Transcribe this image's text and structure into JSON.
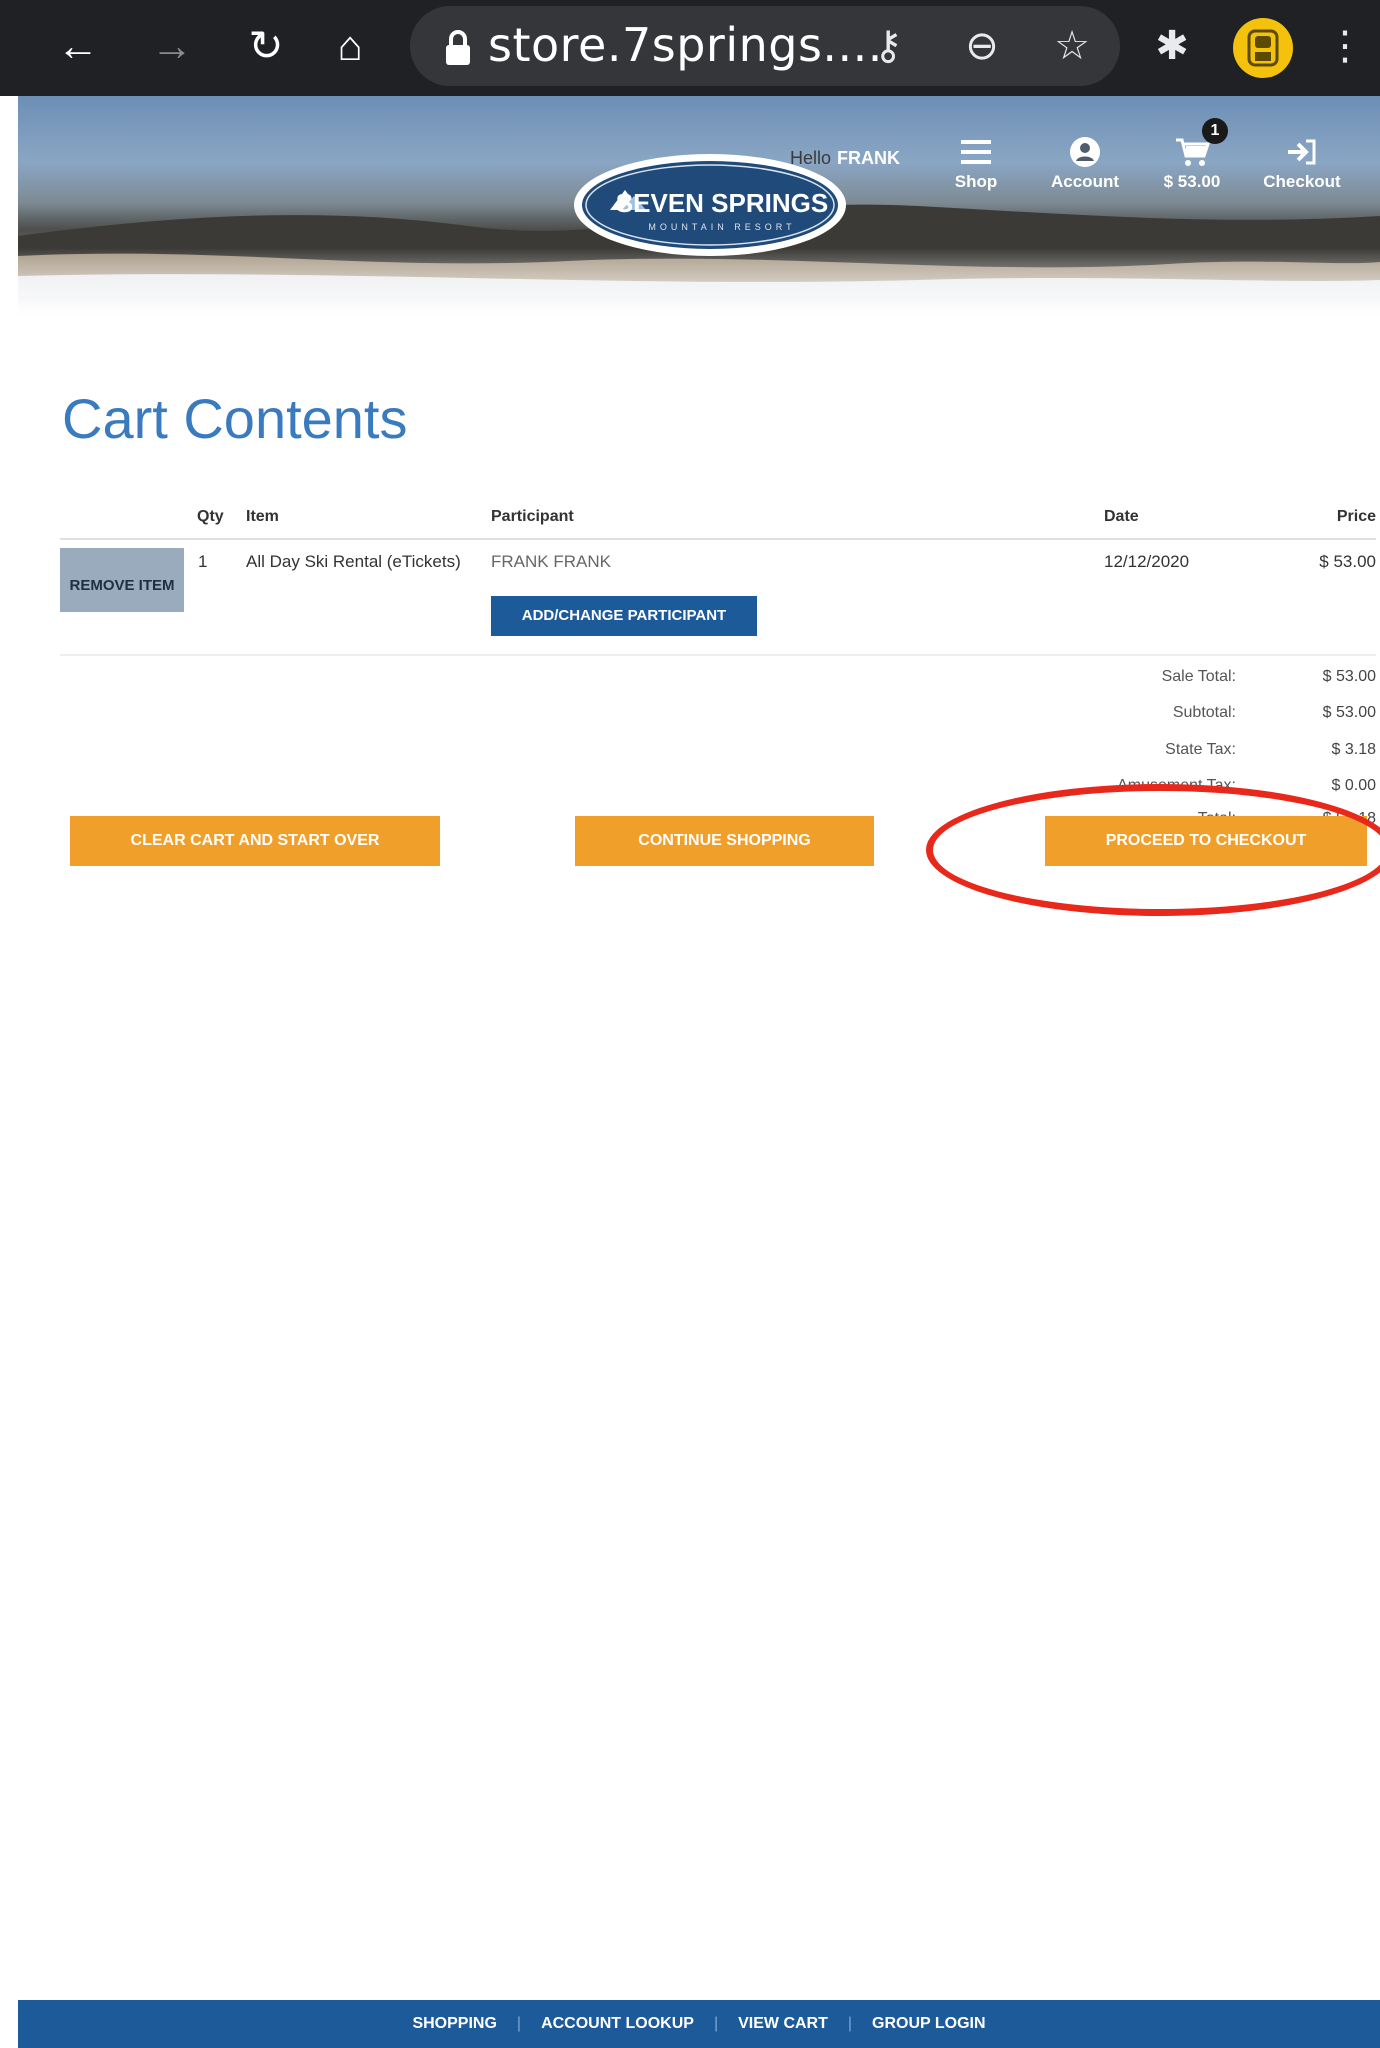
{
  "browser": {
    "url": "store.7springs....",
    "back_icon": "←",
    "forward_icon": "→",
    "reload_icon": "↻",
    "home_icon": "⌂",
    "key_icon": "⚷",
    "zoom_icon": "⊖",
    "star_icon": "☆",
    "extensions_icon": "✱",
    "menu_icon": "⋮"
  },
  "header": {
    "greeting": "Hello",
    "user": "FRANK",
    "nav": {
      "shop": "Shop",
      "account": "Account",
      "cart_total": "$ 53.00",
      "cart_count": "1",
      "checkout": "Checkout"
    },
    "logo_text": "SEVEN SPRINGS",
    "logo_subtext": "MOUNTAIN RESORT"
  },
  "cart": {
    "title": "Cart Contents",
    "columns": {
      "qty": "Qty",
      "item": "Item",
      "participant": "Participant",
      "date": "Date",
      "price": "Price"
    },
    "rows": [
      {
        "remove_label": "REMOVE ITEM",
        "qty": "1",
        "item": "All Day Ski Rental (eTickets)",
        "participant": "FRANK FRANK",
        "change_participant_label": "ADD/CHANGE PARTICIPANT",
        "date": "12/12/2020",
        "price": "$ 53.00"
      }
    ],
    "summary": {
      "sale_total_label": "Sale Total:",
      "sale_total": "$ 53.00",
      "subtotal_label": "Subtotal:",
      "subtotal": "$ 53.00",
      "state_tax_label": "State Tax:",
      "state_tax": "$ 3.18",
      "amusement_tax_label": "Amusement Tax:",
      "amusement_tax": "$ 0.00",
      "total_label": "Total:",
      "total": "$ 56.18"
    },
    "actions": {
      "clear": "CLEAR CART AND START OVER",
      "continue": "CONTINUE SHOPPING",
      "checkout": "PROCEED TO CHECKOUT"
    }
  },
  "footer": {
    "links": [
      "SHOPPING",
      "ACCOUNT LOOKUP",
      "VIEW CART",
      "GROUP LOGIN"
    ]
  },
  "colors": {
    "accent_orange": "#f0a02a",
    "brand_blue": "#1d5a99",
    "title_blue": "#3a7bbf",
    "highlight_red": "#e8281b"
  }
}
